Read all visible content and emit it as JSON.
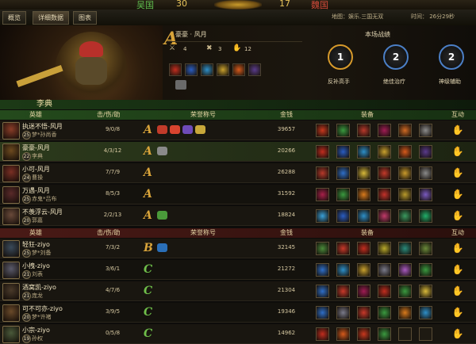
{
  "topbar": {
    "left_country": "吴国",
    "left_score": "30",
    "right_score": "17",
    "right_country": "魏国"
  },
  "nav": {
    "tabs": [
      "概览",
      "详细数据",
      "图表"
    ],
    "map_label": "地图：娱乐.三国无双",
    "time_label": "时间：  26分29秒"
  },
  "hero_panel": {
    "grade": "A",
    "player": "豪豪 · 风月",
    "stats": [
      "4",
      "3",
      "12"
    ],
    "battle_title": "本场战绩",
    "badges": [
      {
        "label": "反补高手",
        "rank": "1",
        "color": "#d79a2b"
      },
      {
        "label": "绝佳治疗",
        "rank": "2",
        "color": "#4b7fc6"
      },
      {
        "label": "神级辅助",
        "rank": "2",
        "color": "#4b7fc6"
      }
    ]
  },
  "selected_hero": "李典",
  "headers": {
    "hero": "英雄",
    "kda": "击/伤/助",
    "honor": "荣誉称号",
    "gold": "金钱",
    "equip": "装备",
    "interact": "互动"
  },
  "team_a": [
    {
      "player": "执迷不悟-风月",
      "level": "25",
      "hero": "梦*孙尚香",
      "kda": "9/0/8",
      "grade": "A",
      "gold": "39657",
      "honors": [
        "#c23b2a",
        "#d9442f",
        "#6e4bb8",
        "#c8a83a"
      ],
      "avatar": "#8a3d28",
      "items": [
        "#c9381e",
        "#3a9a3f",
        "#b8392b",
        "#a01c54",
        "#d06a24",
        "#8c8c8c"
      ]
    },
    {
      "player": "豪豪-风月",
      "level": "22",
      "hero": "李典",
      "kda": "4/3/12",
      "grade": "A",
      "gold": "20266",
      "honors": [
        "#8a8a8a"
      ],
      "avatar": "#6d4a1f",
      "highlight": true,
      "items": [
        "#c22d1f",
        "#2a5dc2",
        "#2e8fc8",
        "#c9a12e",
        "#d65a1c",
        "#5a3b8c"
      ]
    },
    {
      "player": "小可-风月",
      "level": "24",
      "hero": "曹操",
      "kda": "7/7/9",
      "grade": "A",
      "gold": "26288",
      "honors": [],
      "avatar": "#7a2f24",
      "items": [
        "#b83a2b",
        "#2f6fc8",
        "#d8b93a",
        "#c43a2a",
        "#c99a2b",
        "#8a8a8a"
      ]
    },
    {
      "player": "万遇-风月",
      "level": "25",
      "hero": "赤鬼*吕布",
      "kda": "8/5/3",
      "grade": "A",
      "gold": "31592",
      "honors": [],
      "avatar": "#5a2a2a",
      "items": [
        "#a8204a",
        "#3a9a3f",
        "#d87a1c",
        "#c4322a",
        "#b89a2b",
        "#7a5ac0"
      ]
    },
    {
      "player": "不羡浮云-风月",
      "level": "20",
      "hero": "郭嘉",
      "kda": "2/2/13",
      "grade": "A",
      "gold": "18824",
      "honors": [
        "#4a9a3a"
      ],
      "avatar": "#6a4a3a",
      "items": [
        "#3aa0d8",
        "#2a5dc2",
        "#2e8fc8",
        "#c23a6a",
        "#3a9a5f",
        "#21b06a"
      ]
    }
  ],
  "team_b": [
    {
      "player": "轻狂-ziyo",
      "level": "25",
      "hero": "梦*刘备",
      "kda": "7/3/2",
      "grade": "B",
      "gold": "32145",
      "honors": [
        "#2a6fb8"
      ],
      "avatar": "#3a4a5a",
      "items": [
        "#4a8a3a",
        "#c8392a",
        "#c22d1f",
        "#b8a92b",
        "#2a8a7a",
        "#6a8a3a"
      ]
    },
    {
      "player": "小拽-ziyo",
      "level": "21",
      "hero": "刘表",
      "kda": "3/6/1",
      "grade": "C",
      "gold": "21272",
      "honors": [],
      "avatar": "#5a5a6a",
      "items": [
        "#2f6fc8",
        "#2e8fc8",
        "#c9a12e",
        "#7a7a8a",
        "#a85ac0",
        "#3a9a3f"
      ]
    },
    {
      "player": "酒窝凯-ziyo",
      "level": "21",
      "hero": "庞龙",
      "kda": "4/7/6",
      "grade": "C",
      "gold": "21304",
      "honors": [],
      "avatar": "#4a3a2a",
      "items": [
        "#2f6fc8",
        "#c8392a",
        "#a01c54",
        "#c22d1f",
        "#3a9a3f",
        "#d8b93a"
      ]
    },
    {
      "player": "可不可亦-ziyo",
      "level": "20",
      "hero": "梦*许褚",
      "kda": "3/9/5",
      "grade": "C",
      "gold": "19346",
      "honors": [],
      "avatar": "#6a4a2a",
      "items": [
        "#2f6fc8",
        "#7a7a8a",
        "#c8392a",
        "#3a9a3f",
        "#d87a1c",
        "#2e8fc8"
      ]
    },
    {
      "player": "小宗-ziyo",
      "level": "19",
      "hero": "孙权",
      "kda": "0/5/8",
      "grade": "C",
      "gold": "14962",
      "honors": [],
      "avatar": "#4a5a3a",
      "items": [
        "#c22d1f",
        "#d65a1c",
        "#c9381e",
        "#3a9a3f",
        "",
        ""
      ]
    }
  ],
  "colors": {
    "grade_a": "#d9a43a",
    "grade_b": "#d9a43a",
    "grade_c": "#6fbf4a",
    "team_a_bar": "#234a1e",
    "team_b_bar": "#4a1616"
  }
}
